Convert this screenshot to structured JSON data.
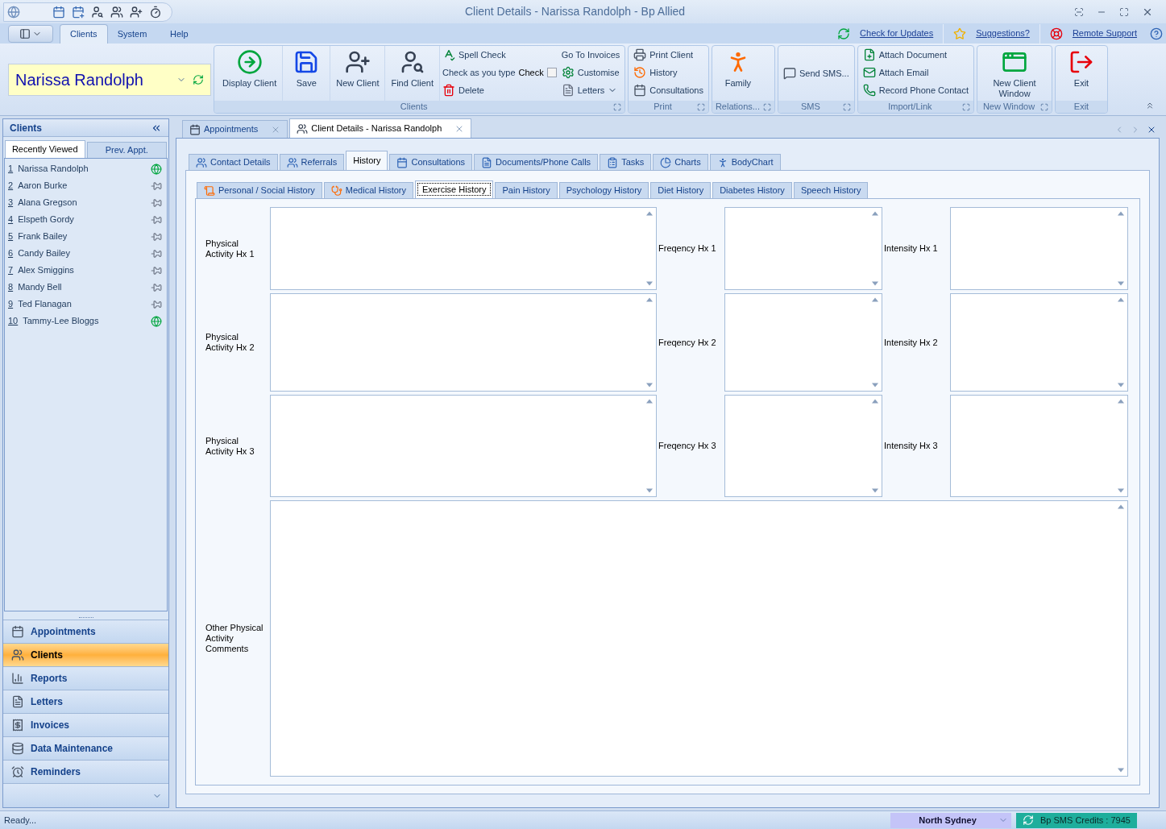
{
  "window": {
    "title": "Client Details - Narissa Randolph - Bp Allied"
  },
  "ribbon_tabs": [
    {
      "label": "Clients",
      "selected": true
    },
    {
      "label": "System",
      "selected": false
    },
    {
      "label": "Help",
      "selected": false
    }
  ],
  "header_links": [
    "Check for Updates",
    "Suggestions?",
    "Remote Support"
  ],
  "client_selector": {
    "value": "Narissa Randolph"
  },
  "ribbon_groups": [
    {
      "label": "Clients",
      "launcher": true,
      "columns": [
        [
          {
            "kind": "large",
            "label": "Display Client"
          }
        ],
        [
          {
            "kind": "large",
            "label": "Save"
          }
        ],
        [
          {
            "kind": "large",
            "label": "New Client"
          }
        ],
        [
          {
            "kind": "large",
            "label": "Find Client"
          }
        ],
        [
          {
            "kind": "small",
            "label": "Spell Check"
          },
          {
            "kind": "checkbox",
            "label": "Check as you type",
            "box_label": "Check",
            "checked": false
          },
          {
            "kind": "small",
            "label": "Delete"
          }
        ],
        [
          {
            "kind": "small",
            "label": "Go To Invoices"
          },
          {
            "kind": "small",
            "label": "Customise"
          },
          {
            "kind": "menu",
            "label": "Letters"
          }
        ]
      ]
    },
    {
      "label": "Print",
      "launcher": true,
      "columns": [
        [
          {
            "kind": "small",
            "label": "Print Client"
          },
          {
            "kind": "small",
            "label": "History"
          },
          {
            "kind": "small",
            "label": "Consultations"
          }
        ]
      ]
    },
    {
      "label": "Relations...",
      "launcher": true,
      "columns": [
        [
          {
            "kind": "large",
            "label": "Family"
          }
        ]
      ]
    },
    {
      "label": "SMS",
      "launcher": true,
      "columns": [
        [
          {
            "kind": "small",
            "label": "Send SMS..."
          }
        ]
      ]
    },
    {
      "label": "Import/Link",
      "launcher": true,
      "columns": [
        [
          {
            "kind": "small",
            "label": "Attach Document"
          },
          {
            "kind": "small",
            "label": "Attach Email"
          },
          {
            "kind": "small",
            "label": "Record Phone Contact"
          }
        ]
      ]
    },
    {
      "label": "New Window",
      "launcher": true,
      "columns": [
        [
          {
            "kind": "large",
            "label": "New Client Window"
          }
        ]
      ]
    },
    {
      "label": "Exit",
      "launcher": false,
      "columns": [
        [
          {
            "kind": "large",
            "label": "Exit"
          }
        ]
      ]
    }
  ],
  "sidebar": {
    "title": "Clients",
    "tabs": [
      {
        "label": "Recently Viewed",
        "selected": true
      },
      {
        "label": "Prev. Appt.",
        "selected": false
      }
    ],
    "items": [
      {
        "number": "1",
        "name": "Narissa Randolph",
        "kind": "online"
      },
      {
        "number": "2",
        "name": "Aaron Burke",
        "kind": "pinned"
      },
      {
        "number": "3",
        "name": "Alana Gregson",
        "kind": "pinned"
      },
      {
        "number": "4",
        "name": "Elspeth Gordy",
        "kind": "pinned"
      },
      {
        "number": "5",
        "name": "Frank Bailey",
        "kind": "pinned"
      },
      {
        "number": "6",
        "name": "Candy Bailey",
        "kind": "pinned"
      },
      {
        "number": "7",
        "name": "Alex Smiggins",
        "kind": "pinned"
      },
      {
        "number": "8",
        "name": "Mandy Bell",
        "kind": "pinned"
      },
      {
        "number": "9",
        "name": "Ted Flanagan",
        "kind": "pinned"
      },
      {
        "number": "10",
        "name": "Tammy-Lee Bloggs",
        "kind": "online"
      }
    ],
    "nav": [
      {
        "label": "Appointments",
        "selected": false
      },
      {
        "label": "Clients",
        "selected": true
      },
      {
        "label": "Reports",
        "selected": false
      },
      {
        "label": "Letters",
        "selected": false
      },
      {
        "label": "Invoices",
        "selected": false
      },
      {
        "label": "Data Maintenance",
        "selected": false
      },
      {
        "label": "Reminders",
        "selected": false
      }
    ]
  },
  "document_tabs": [
    {
      "label": "Appointments",
      "selected": false
    },
    {
      "label": "Client Details - Narissa Randolph",
      "selected": true
    }
  ],
  "section_tabs": [
    {
      "label": "Contact Details",
      "selected": false
    },
    {
      "label": "Referrals",
      "selected": false
    },
    {
      "label": "History",
      "selected": true
    },
    {
      "label": "Consultations",
      "selected": false
    },
    {
      "label": "Documents/Phone Calls",
      "selected": false
    },
    {
      "label": "Tasks",
      "selected": false
    },
    {
      "label": "Charts",
      "selected": false
    },
    {
      "label": "BodyChart",
      "selected": false
    }
  ],
  "history_tabs": [
    {
      "label": "Personal / Social History",
      "selected": false
    },
    {
      "label": "Medical History",
      "selected": false
    },
    {
      "label": "Exercise History",
      "selected": true
    },
    {
      "label": "Pain History",
      "selected": false
    },
    {
      "label": "Psychology History",
      "selected": false
    },
    {
      "label": "Diet History",
      "selected": false
    },
    {
      "label": "Diabetes History",
      "selected": false
    },
    {
      "label": "Speech History",
      "selected": false
    }
  ],
  "form_rows": [
    [
      {
        "label": "Physical Activity Hx 1"
      },
      {
        "label": "Freqency Hx 1"
      },
      {
        "label": "Intensity Hx 1"
      }
    ],
    [
      {
        "label": "Physical Activity Hx 2"
      },
      {
        "label": "Freqency Hx 2"
      },
      {
        "label": "Intensity Hx 2"
      }
    ],
    [
      {
        "label": "Physical Activity Hx 3"
      },
      {
        "label": "Freqency Hx 3"
      },
      {
        "label": "Intensity Hx 3"
      }
    ]
  ],
  "comments": {
    "label": "Other Physical Activity Comments"
  },
  "status_bar": {
    "message": "Ready...",
    "location": "North Sydney",
    "credits": "Bp SMS Credits : 7945"
  }
}
